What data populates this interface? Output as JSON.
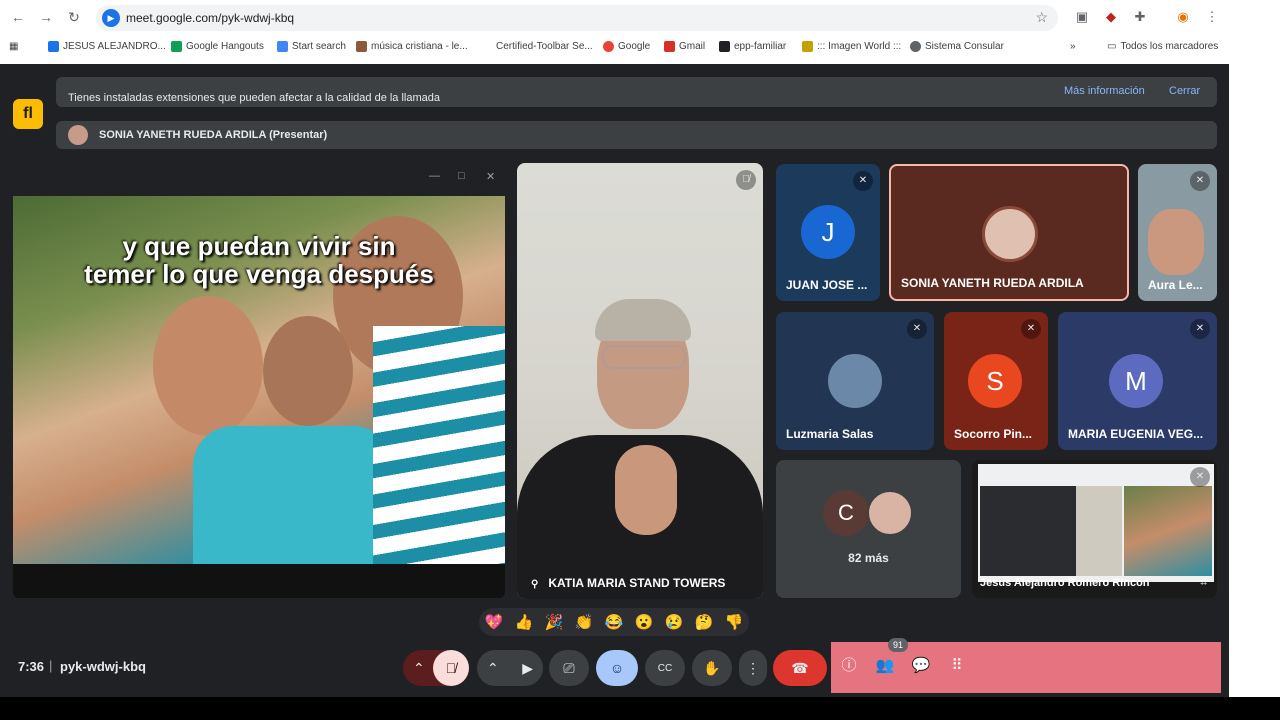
{
  "browser": {
    "url": "meet.google.com/pyk-wdwj-kbq",
    "bookmarks": [
      "JESUS ALEJANDRO...",
      "Google Hangouts",
      "Start search",
      "música cristiana - le...",
      "Certified-Toolbar Se...",
      "Google",
      "Gmail",
      "epp-familiar",
      "::: Imagen World :::",
      "Sistema Consular"
    ],
    "all_bookmarks": "Todos los marcadores",
    "overflow": "»"
  },
  "banner": {
    "text": "Tienes instaladas extensiones que pueden afectar a la calidad de la llamada",
    "more_info": "Más información",
    "close": "Cerrar"
  },
  "presenter": {
    "label": "SONIA YANETH RUEDA ARDILA (Presentar)"
  },
  "share": {
    "caption_line1": "y que puedan vivir sin",
    "caption_line2": "temer lo que venga después"
  },
  "participants": {
    "katia": "KATIA MARIA STAND TOWERS",
    "juan": "JUAN JOSE ...",
    "juan_initial": "J",
    "sonia": "SONIA YANETH RUEDA ARDILA",
    "aura": "Aura Le...",
    "luzmaria": "Luzmaria Salas",
    "socorro": "Socorro Pin...",
    "socorro_initial": "S",
    "maria": "MARIA EUGENIA VEG...",
    "maria_initial": "M",
    "more_initial": "C",
    "more_count": "82 más",
    "self": "Jesus Alejandro Romero Rincon"
  },
  "reactions": [
    "💖",
    "👍",
    "🎉",
    "👏",
    "😂",
    "😮",
    "😢",
    "🤔",
    "👎"
  ],
  "footer": {
    "time": "7:36",
    "separator": "|",
    "meeting_code": "pyk-wdwj-kbq",
    "people_count": "91"
  },
  "icons": {
    "mic_off": "mic-off-icon",
    "camera": "video-camera-icon",
    "present": "present-screen-icon",
    "emoji": "emoji-icon",
    "captions": "closed-captions-icon",
    "hand": "raise-hand-icon",
    "more": "more-vert-icon",
    "hangup": "hangup-icon",
    "info": "info-icon",
    "people": "people-icon",
    "chat": "chat-icon",
    "activities": "apps-grid-icon"
  },
  "colors": {
    "meet_bg": "#202124",
    "hangup": "#dc362e",
    "emoji_active": "#a8c7fa",
    "side_bar": "#e57480"
  }
}
